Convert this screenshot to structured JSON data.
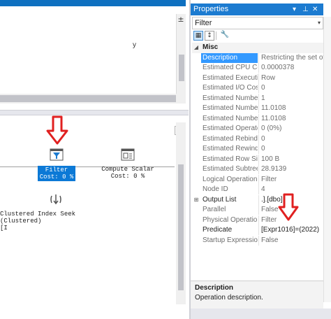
{
  "query_pane": {
    "text": "y",
    "splitter_glyph": "±"
  },
  "plan": {
    "operators": [
      {
        "name": "filter",
        "label_line1": "Filter",
        "label_line2": "Cost: 0 %"
      },
      {
        "name": "compute-scalar",
        "label_line1": "Compute Scalar",
        "label_line2": "Cost: 0 %"
      },
      {
        "name": "index-seek",
        "label_line1": "Clustered Index Seek (Clustered)",
        "label_line2": "[I"
      }
    ],
    "arrow_color": "#e02020"
  },
  "properties": {
    "title": "Properties",
    "header_controls": {
      "dropdown": "▾",
      "pin": "⊥",
      "close": "✕"
    },
    "object": "Filter",
    "combo_glyph": "▾",
    "toolbar": {
      "categorized": "▦",
      "alphabetical": "↕",
      "property_pages": "🔧"
    },
    "category": {
      "label": "Misc",
      "glyph": "◢"
    },
    "rows": [
      {
        "name": "Description",
        "value": "Restricting the set of ro",
        "selected": true
      },
      {
        "name": "Estimated CPU Cos",
        "value": "0.0000378"
      },
      {
        "name": "Estimated Executio",
        "value": "Row"
      },
      {
        "name": "Estimated I/O Cost",
        "value": "0"
      },
      {
        "name": "Estimated Number",
        "value": "1"
      },
      {
        "name": "Estimated Number",
        "value": "11.0108"
      },
      {
        "name": "Estimated Number",
        "value": "11.0108"
      },
      {
        "name": "Estimated Operato",
        "value": "0 (0%)"
      },
      {
        "name": "Estimated Rebinds",
        "value": "0"
      },
      {
        "name": "Estimated Rewinds",
        "value": "0"
      },
      {
        "name": "Estimated Row Size",
        "value": "100 B"
      },
      {
        "name": "Estimated Subtree",
        "value": "28.9139"
      },
      {
        "name": "Logical Operation",
        "value": "Filter"
      },
      {
        "name": "Node ID",
        "value": "4"
      },
      {
        "name": "Output List",
        "value": ".].[dbo].",
        "expandable": true,
        "glyph": "⊞",
        "dark": true
      },
      {
        "name": "Parallel",
        "value": "False"
      },
      {
        "name": "Physical Operation",
        "value": "Filter"
      },
      {
        "name": "Predicate",
        "value": "[Expr1016]=(2022)",
        "dark": true
      },
      {
        "name": "Startup Expression",
        "value": "False"
      }
    ],
    "description": {
      "title": "Description",
      "text": "Operation description."
    }
  }
}
